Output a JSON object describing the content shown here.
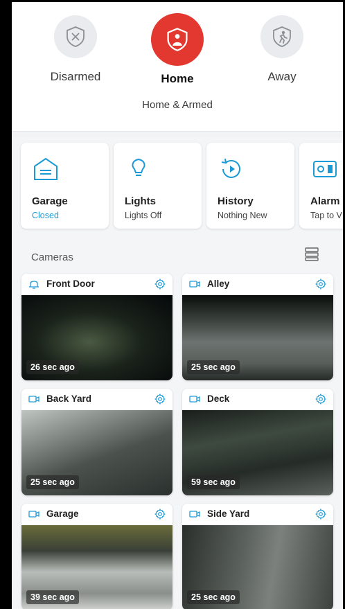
{
  "modes": {
    "disarmed": "Disarmed",
    "home": "Home",
    "away": "Away",
    "status": "Home & Armed"
  },
  "tiles": [
    {
      "title": "Garage",
      "subtitle": "Closed",
      "icon": "garage-icon"
    },
    {
      "title": "Lights",
      "subtitle": "Lights Off",
      "icon": "lightbulb-icon"
    },
    {
      "title": "History",
      "subtitle": "Nothing New",
      "icon": "history-icon"
    },
    {
      "title": "Alarm",
      "subtitle": "Tap to V",
      "icon": "alarm-base-icon"
    }
  ],
  "cameras_heading": "Cameras",
  "cameras": [
    {
      "name": "Front Door",
      "timestamp": "26 sec ago",
      "icon": "doorbell-icon"
    },
    {
      "name": "Alley",
      "timestamp": "25 sec ago",
      "icon": "camera-icon"
    },
    {
      "name": "Back Yard",
      "timestamp": "25 sec ago",
      "icon": "camera-icon"
    },
    {
      "name": "Deck",
      "timestamp": "59 sec ago",
      "icon": "camera-icon"
    },
    {
      "name": "Garage",
      "timestamp": "39 sec ago",
      "icon": "camera-icon"
    },
    {
      "name": "Side Yard",
      "timestamp": "25 sec ago",
      "icon": "camera-icon"
    }
  ],
  "colors": {
    "accent_red": "#e2382f",
    "accent_blue": "#1c9ad6"
  }
}
